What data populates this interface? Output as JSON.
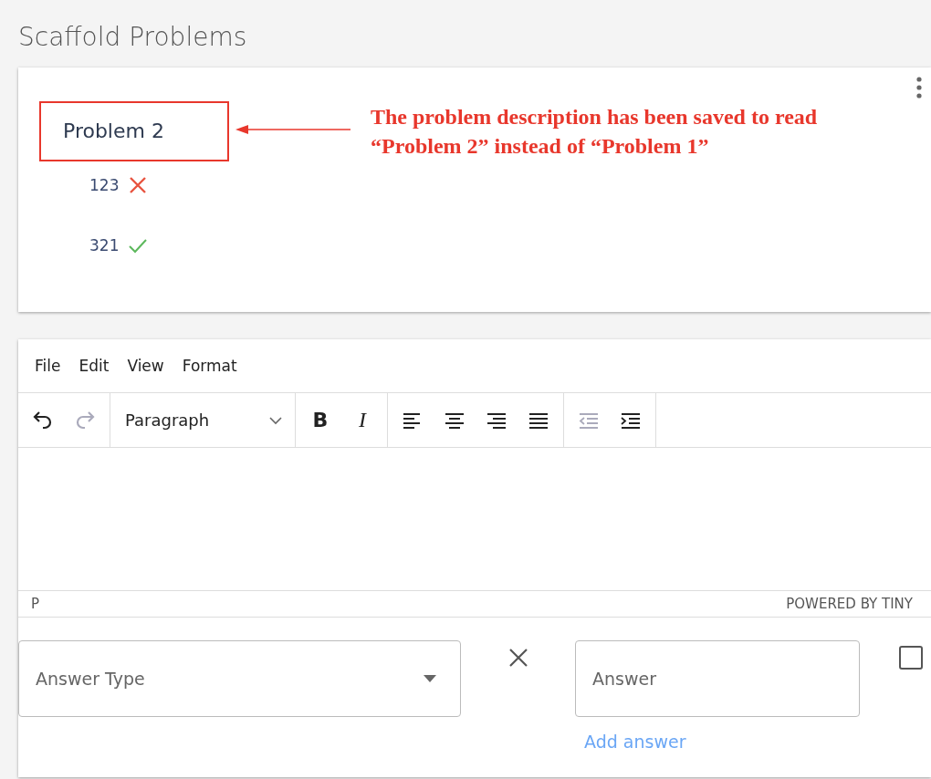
{
  "page_title": "Scaffold Problems",
  "problem": {
    "title": "Problem 2",
    "answers": [
      {
        "text": "123",
        "correct": false
      },
      {
        "text": "321",
        "correct": true
      }
    ]
  },
  "annotation": {
    "text": "The problem description has been saved to read “Problem 2” instead of “Problem 1”"
  },
  "editor": {
    "menu": [
      "File",
      "Edit",
      "View",
      "Format"
    ],
    "toolbar": [
      [
        {
          "kind": "undo",
          "disabled": false
        },
        {
          "kind": "redo",
          "disabled": true
        }
      ],
      [
        {
          "kind": "select",
          "label": "Paragraph"
        }
      ],
      [
        {
          "kind": "bold",
          "label": "B",
          "disabled": false
        },
        {
          "kind": "italic",
          "label": "I",
          "disabled": false
        }
      ],
      [
        {
          "kind": "align-left",
          "disabled": false
        },
        {
          "kind": "align-center",
          "disabled": false
        },
        {
          "kind": "align-right",
          "disabled": false
        },
        {
          "kind": "justify",
          "disabled": false
        }
      ],
      [
        {
          "kind": "outdent",
          "disabled": true
        },
        {
          "kind": "indent",
          "disabled": false
        }
      ]
    ],
    "status_path": "P",
    "branding": "POWERED BY TINY"
  },
  "answer_form": {
    "answer_type": {
      "placeholder": "Answer Type"
    },
    "answer": {
      "placeholder": "Answer"
    },
    "add_link": "Add answer",
    "checkbox": {
      "checked": false
    }
  }
}
